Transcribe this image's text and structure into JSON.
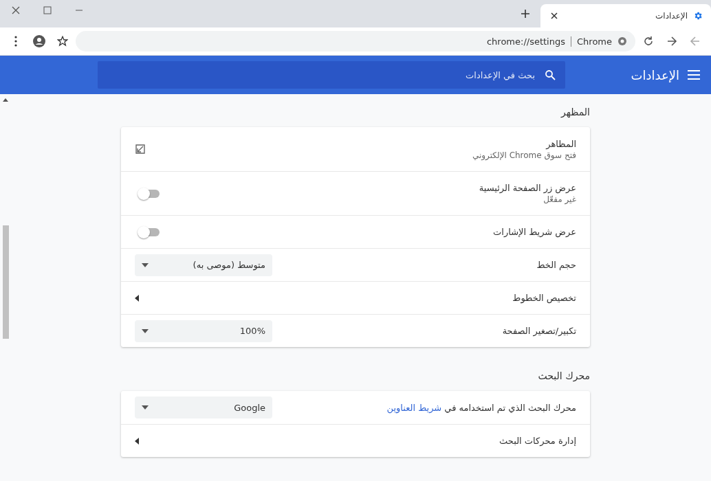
{
  "browser": {
    "tab": {
      "title": "الإعدادات"
    },
    "address": {
      "site": "Chrome",
      "url": "chrome://settings"
    }
  },
  "header": {
    "title": "الإعدادات",
    "search": {
      "placeholder": "بحث في الإعدادات"
    }
  },
  "sections": [
    {
      "title": "المظهر",
      "rows": [
        {
          "kind": "link",
          "label": "المظاهر",
          "sublabel": "فتح سوق Chrome الإلكتروني"
        },
        {
          "kind": "toggle",
          "label": "عرض زر الصفحة الرئيسية",
          "sublabel": "غير مفعّل",
          "on": false
        },
        {
          "kind": "toggle",
          "label": "عرض شريط الإشارات",
          "on": false
        },
        {
          "kind": "select",
          "label": "حجم الخط",
          "value": "متوسط (موصى به)"
        },
        {
          "kind": "submenu",
          "label": "تخصيص الخطوط"
        },
        {
          "kind": "select",
          "label": "تكبير/تصغير الصفحة",
          "value": "100%"
        }
      ]
    },
    {
      "title": "محرك البحث",
      "rows": [
        {
          "kind": "select",
          "label": "محرك البحث الذي تم استخدامه في",
          "link": "شريط العناوين",
          "value": "Google"
        },
        {
          "kind": "submenu",
          "label": "إدارة محركات البحث"
        }
      ]
    }
  ]
}
